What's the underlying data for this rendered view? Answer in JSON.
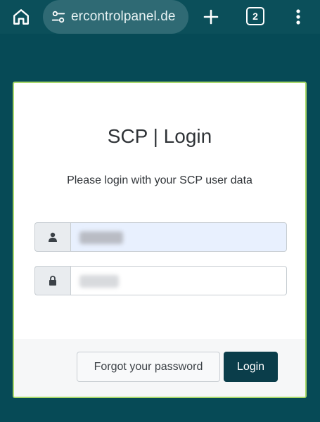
{
  "browser": {
    "url_text": "ercontrolpanel.de",
    "tab_count": "2",
    "icons": {
      "home": "home-icon",
      "site_settings": "site-settings-icon",
      "new_tab": "plus-icon",
      "menu": "more-vertical-icon"
    }
  },
  "card": {
    "title": "SCP | Login",
    "subtitle": "Please login with your SCP user data",
    "username": {
      "icon": "user-icon",
      "value": ""
    },
    "password": {
      "icon": "lock-icon",
      "value": ""
    },
    "forgot_label": "Forgot your password",
    "login_label": "Login"
  },
  "colors": {
    "page_bg": "#064a56",
    "toolbar_bg": "#0b4f5a",
    "card_border": "#a8d86a",
    "login_button": "#0a3d4a",
    "autofill_bg": "#e8f0fe"
  }
}
